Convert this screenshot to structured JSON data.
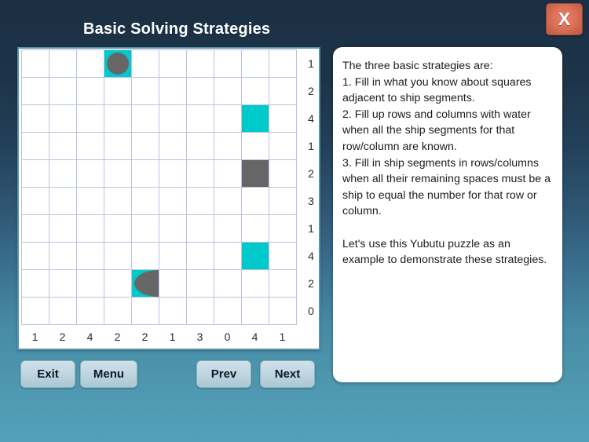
{
  "header": {
    "title": "Basic Solving Strategies",
    "close_label": "X"
  },
  "board": {
    "size": 10,
    "row_clues": [
      1,
      2,
      4,
      1,
      2,
      3,
      1,
      4,
      2,
      0
    ],
    "col_clues": [
      1,
      2,
      4,
      2,
      2,
      1,
      3,
      0,
      4,
      1
    ],
    "cells": [
      {
        "row": 0,
        "col": 3,
        "type": "ship-circle"
      },
      {
        "row": 2,
        "col": 8,
        "type": "water"
      },
      {
        "row": 4,
        "col": 8,
        "type": "ship-sq"
      },
      {
        "row": 7,
        "col": 8,
        "type": "water"
      },
      {
        "row": 8,
        "col": 4,
        "type": "ship-end-right"
      }
    ]
  },
  "info": {
    "text": "The three basic strategies are:\n1. Fill in what you know about squares adjacent to ship segments.\n2. Fill up rows and columns with water when all the ship segments for that row/column are known.\n3. Fill in ship segments in rows/columns when all their remaining spaces must be a ship to equal the number for that row or column.\n\nLet's use this Yubutu puzzle as an example to demonstrate these strategies."
  },
  "buttons": {
    "exit": "Exit",
    "menu": "Menu",
    "prev": "Prev",
    "next": "Next"
  },
  "colors": {
    "water": "#00c9cc",
    "ship": "#666666",
    "accent": "#5a93ae",
    "close": "#dd7158"
  }
}
